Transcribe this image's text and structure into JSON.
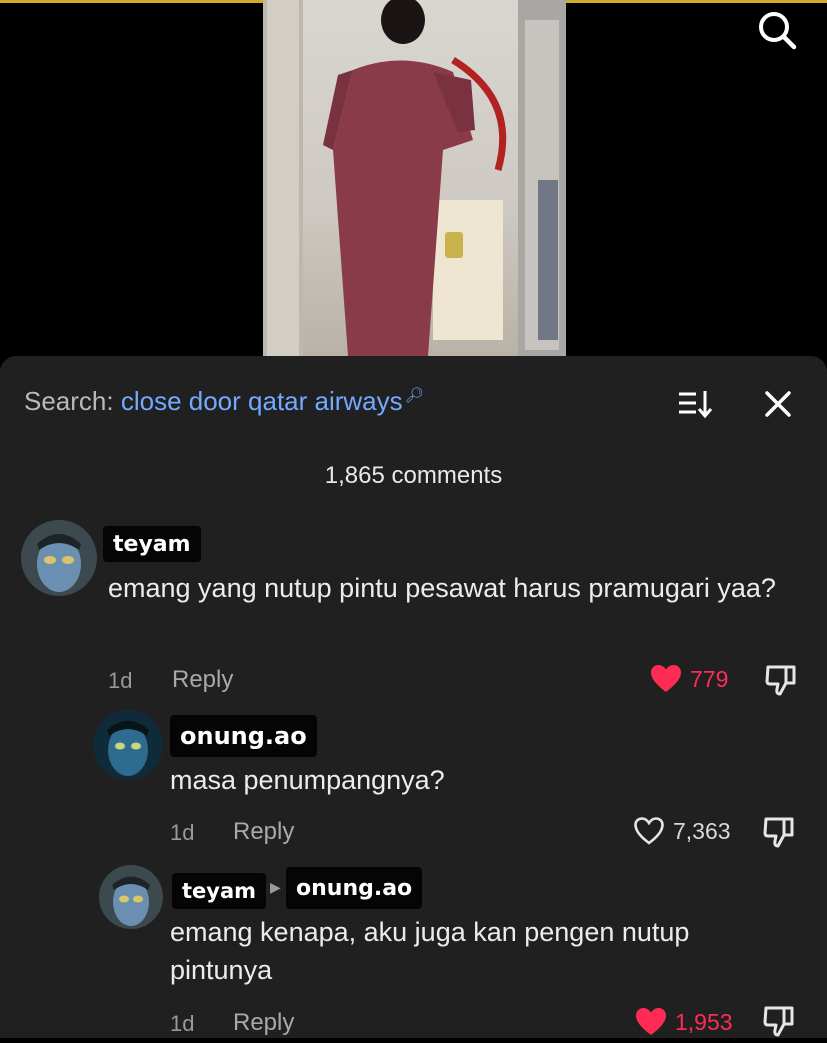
{
  "header": {
    "search_label": "Search:",
    "search_query": "close door qatar airways"
  },
  "comments_count": "1,865 comments",
  "comments": [
    {
      "username": "teyam",
      "text": "emang yang nutup pintu pesawat harus pramugari yaa?",
      "age": "1d",
      "reply_label": "Reply",
      "likes": "779",
      "liked": true
    },
    {
      "username": "onung.ao",
      "text": "masa penumpangnya?",
      "age": "1d",
      "reply_label": "Reply",
      "likes": "7,363",
      "liked": false
    },
    {
      "username": "teyam",
      "reply_to": "onung.ao",
      "text": "emang kenapa, aku juga kan pengen nutup pintunya",
      "age": "1d",
      "reply_label": "Reply",
      "likes": "1,953",
      "liked": true
    }
  ],
  "colors": {
    "panel_bg": "#202021",
    "query_blue": "#73a9ff",
    "like_red": "#fe2c55"
  },
  "icons": [
    "search-icon",
    "sort-icon",
    "close-icon",
    "heart-icon",
    "dislike-icon",
    "reply-arrow-icon"
  ]
}
